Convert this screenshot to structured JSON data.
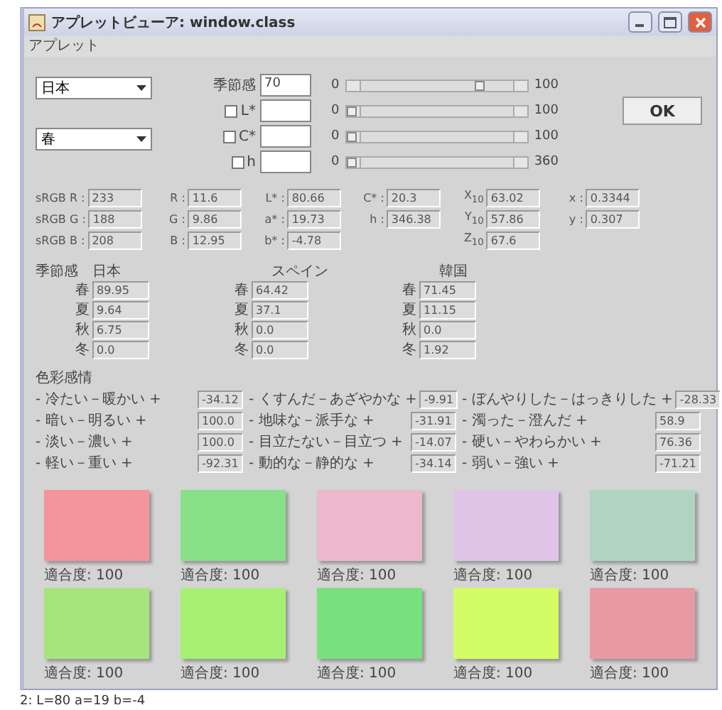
{
  "window": {
    "title": "アプレットビューア: window.class"
  },
  "menu": [
    "アプレット"
  ],
  "selectors": [
    {
      "value": "日本"
    },
    {
      "value": "春"
    }
  ],
  "controls": [
    {
      "kind": "plain",
      "label": "季節感",
      "value": "70",
      "min": "0",
      "max": "100",
      "level": 0.7
    },
    {
      "kind": "check",
      "label": "L*",
      "checked": false,
      "min": "0",
      "max": "100",
      "level": 0
    },
    {
      "kind": "check",
      "label": "C*",
      "checked": false,
      "min": "0",
      "max": "100",
      "level": 0
    },
    {
      "kind": "check",
      "label": "h",
      "checked": false,
      "min": "0",
      "max": "360",
      "level": 0
    }
  ],
  "ok_button": "OK",
  "color_values": [
    [
      {
        "label": "sRGB R :",
        "value": "233"
      },
      {
        "label": "sRGB G :",
        "value": "188"
      },
      {
        "label": "sRGB B :",
        "value": "208"
      }
    ],
    [
      {
        "label": "R :",
        "value": "11.6"
      },
      {
        "label": "G :",
        "value": "9.86"
      },
      {
        "label": "B :",
        "value": "12.95"
      }
    ],
    [
      {
        "label": "L* :",
        "value": "80.66"
      },
      {
        "label": "a* :",
        "value": "19.73"
      },
      {
        "label": "b* :",
        "value": "-4.78"
      }
    ],
    [
      {
        "label": "C* :",
        "value": "20.3"
      },
      {
        "label": "h :",
        "value": "346.38"
      }
    ],
    [
      {
        "label": "X$_{10}$",
        "value": "63.02"
      },
      {
        "label": "Y$_{10}$",
        "value": "57.86"
      },
      {
        "label": "Z$_{10}$",
        "value": "67.6"
      }
    ],
    [
      {
        "label": "x :",
        "value": "0.3344"
      },
      {
        "label": "y :",
        "value": "0.307"
      }
    ]
  ],
  "seasonality": {
    "label": "季節感",
    "countries": [
      {
        "name": "日本",
        "rows": [
          {
            "season": "春",
            "value": "89.95"
          },
          {
            "season": "夏",
            "value": "9.64"
          },
          {
            "season": "秋",
            "value": "6.75"
          },
          {
            "season": "冬",
            "value": "0.0"
          }
        ]
      },
      {
        "name": "スペイン",
        "rows": [
          {
            "season": "春",
            "value": "64.42"
          },
          {
            "season": "夏",
            "value": "37.1"
          },
          {
            "season": "秋",
            "value": "0.0"
          },
          {
            "season": "冬",
            "value": "0.0"
          }
        ]
      },
      {
        "name": "韓国",
        "rows": [
          {
            "season": "春",
            "value": "71.45"
          },
          {
            "season": "夏",
            "value": "11.15"
          },
          {
            "season": "秋",
            "value": "0.0"
          },
          {
            "season": "冬",
            "value": "1.92"
          }
        ]
      }
    ]
  },
  "color_emotion": {
    "title": "色彩感情",
    "columns": [
      [
        {
          "label": "- 冷たい－暖かい +",
          "value": "-34.12"
        },
        {
          "label": "- 暗い－明るい +",
          "value": "100.0"
        },
        {
          "label": "- 淡い－濃い +",
          "value": "100.0"
        },
        {
          "label": "- 軽い－重い +",
          "value": "-92.31"
        }
      ],
      [
        {
          "label": "- くすんだ－あざやかな +",
          "value": "-9.91"
        },
        {
          "label": "- 地味な－派手な +",
          "value": "-31.91"
        },
        {
          "label": "- 目立たない－目立つ +",
          "value": "-14.07"
        },
        {
          "label": "- 動的な－静的な +",
          "value": "-34.14"
        }
      ],
      [
        {
          "label": "- ぼんやりした－はっきりした +",
          "value": "-28.33"
        },
        {
          "label": "- 濁った－澄んだ +",
          "value": "58.9"
        },
        {
          "label": "- 硬い－やわらかい +",
          "value": "76.36"
        },
        {
          "label": "- 弱い－強い +",
          "value": "-71.21"
        }
      ]
    ]
  },
  "swatches": [
    {
      "color": "#f4949c",
      "caption": "適合度: 100"
    },
    {
      "color": "#88e088",
      "caption": "適合度: 100"
    },
    {
      "color": "#ecb8cc",
      "caption": "適合度: 100"
    },
    {
      "color": "#e0c4e8",
      "caption": "適合度: 100"
    },
    {
      "color": "#b0d4c0",
      "caption": "適合度: 100"
    },
    {
      "color": "#a8e47c",
      "caption": "適合度: 100"
    },
    {
      "color": "#a8f074",
      "caption": "適合度: 100"
    },
    {
      "color": "#78e07c",
      "caption": "適合度: 100"
    },
    {
      "color": "#d4fc64",
      "caption": "適合度: 100"
    },
    {
      "color": "#e89aa4",
      "caption": "適合度: 100"
    }
  ],
  "status": "2: L=80 a=19 b=-4"
}
